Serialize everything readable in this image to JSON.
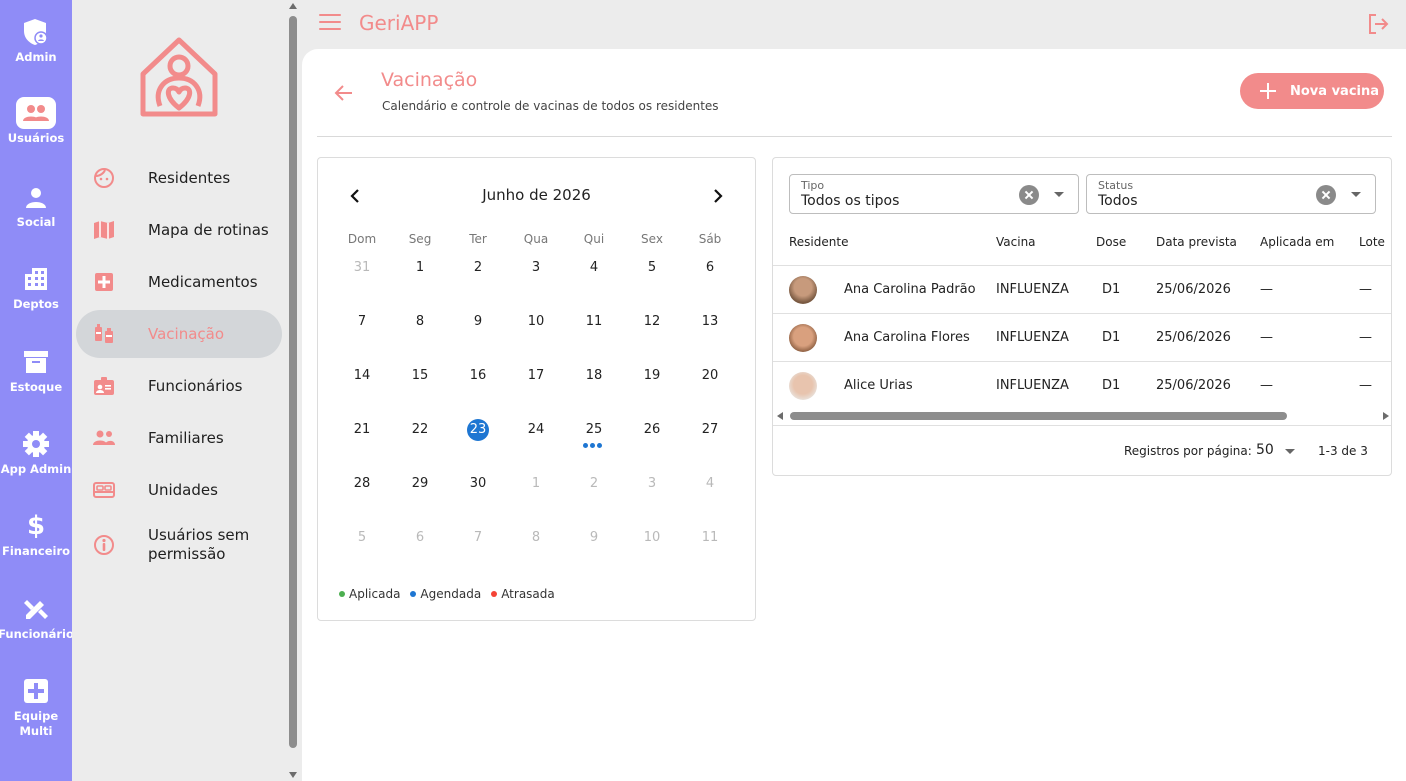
{
  "app": {
    "title": "GeriAPP"
  },
  "rail": [
    {
      "label": "Admin",
      "icon": "shield-user-icon"
    },
    {
      "label": "Usuários",
      "icon": "users-icon"
    },
    {
      "label": "Social",
      "icon": "person-icon"
    },
    {
      "label": "Deptos",
      "icon": "building-icon"
    },
    {
      "label": "Estoque",
      "icon": "archive-icon"
    },
    {
      "label": "App Admin",
      "icon": "gear-icon"
    },
    {
      "label": "Financeiro",
      "icon": "dollar-icon"
    },
    {
      "label": "Funcionário",
      "icon": "pencil-ruler-icon"
    },
    {
      "label": "Equipe",
      "label2": "Multi",
      "icon": "medical-plus-icon"
    }
  ],
  "nav": [
    {
      "label": "Residentes",
      "icon": "face-icon"
    },
    {
      "label": "Mapa de rotinas",
      "icon": "map-icon"
    },
    {
      "label": "Medicamentos",
      "icon": "medical-box-icon"
    },
    {
      "label": "Vacinação",
      "icon": "vaccine-icon"
    },
    {
      "label": "Funcionários",
      "icon": "badge-icon"
    },
    {
      "label": "Familiares",
      "icon": "family-icon"
    },
    {
      "label": "Unidades",
      "icon": "bed-icon"
    },
    {
      "label": "Usuários sem",
      "label2": "permissão",
      "icon": "info-icon"
    }
  ],
  "page": {
    "title": "Vacinação",
    "subtitle": "Calendário e controle de vacinas de todos os residentes",
    "new_button": "Nova vacina"
  },
  "calendar": {
    "month": "Junho de 2026",
    "weekdays": [
      "Dom",
      "Seg",
      "Ter",
      "Qua",
      "Qui",
      "Sex",
      "Sáb"
    ],
    "weeks": [
      [
        "31",
        "1",
        "2",
        "3",
        "4",
        "5",
        "6"
      ],
      [
        "7",
        "8",
        "9",
        "10",
        "11",
        "12",
        "13"
      ],
      [
        "14",
        "15",
        "16",
        "17",
        "18",
        "19",
        "20"
      ],
      [
        "21",
        "22",
        "23",
        "24",
        "25",
        "26",
        "27"
      ],
      [
        "28",
        "29",
        "30",
        "1",
        "2",
        "3",
        "4"
      ],
      [
        "5",
        "6",
        "7",
        "8",
        "9",
        "10",
        "11"
      ]
    ],
    "today": "23",
    "scheduled_day": "25",
    "scheduled_count": 3,
    "legend": [
      {
        "label": "Aplicada",
        "color": "#4caf50"
      },
      {
        "label": "Agendada",
        "color": "#1e76d2"
      },
      {
        "label": "Atrasada",
        "color": "#f44336"
      }
    ]
  },
  "filters": {
    "tipo_label": "Tipo",
    "tipo_value": "Todos os tipos",
    "status_label": "Status",
    "status_value": "Todos"
  },
  "table": {
    "columns": [
      "Residente",
      "Vacina",
      "Dose",
      "Data prevista",
      "Aplicada em",
      "Lote"
    ],
    "rows": [
      {
        "residente": "Ana Carolina Padrão",
        "vacina": "INFLUENZA",
        "dose": "D1",
        "data": "25/06/2026",
        "aplicada": "—",
        "lote": "—"
      },
      {
        "residente": "Ana Carolina Flores",
        "vacina": "INFLUENZA",
        "dose": "D1",
        "data": "25/06/2026",
        "aplicada": "—",
        "lote": "—"
      },
      {
        "residente": "Alice Urias",
        "vacina": "INFLUENZA",
        "dose": "D1",
        "data": "25/06/2026",
        "aplicada": "—",
        "lote": "—"
      }
    ],
    "pager_label": "Registros por página:",
    "pager_size": "50",
    "pager_range": "1-3 de 3"
  },
  "colors": {
    "accent": "#f28b8b",
    "rail": "#8f8cf7",
    "today": "#1e76d2"
  }
}
